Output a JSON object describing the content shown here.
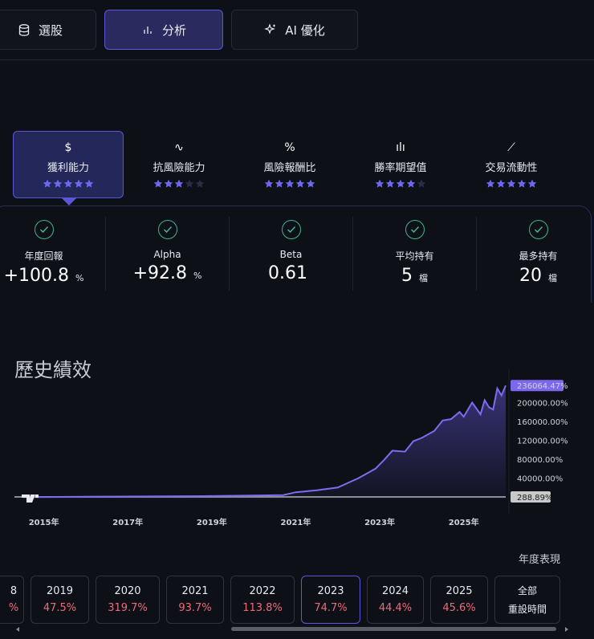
{
  "tabs": [
    {
      "label": "選股",
      "icon": "database-icon"
    },
    {
      "label": "分析",
      "icon": "bar-chart-icon"
    },
    {
      "label": "AI 優化",
      "icon": "sparkle-icon"
    }
  ],
  "metrics": [
    {
      "icon_text": "$",
      "label": "獲利能力",
      "stars": 5
    },
    {
      "icon_text": "∿",
      "label": "抗風險能力",
      "stars": 3
    },
    {
      "icon_text": "%",
      "label": "風險報酬比",
      "stars": 5
    },
    {
      "icon_text": "ılı",
      "label": "勝率期望值",
      "stars": 4
    },
    {
      "icon_text": "⟋",
      "label": "交易流動性",
      "stars": 5
    }
  ],
  "stats": [
    {
      "label": "年度回報",
      "value": "+100.8",
      "unit": "%"
    },
    {
      "label": "Alpha",
      "value": "+92.8",
      "unit": "%"
    },
    {
      "label": "Beta",
      "value": "0.61",
      "unit": ""
    },
    {
      "label": "平均持有",
      "value": "5",
      "unit": "檔"
    },
    {
      "label": "最多持有",
      "value": "20",
      "unit": "檔"
    }
  ],
  "history": {
    "title": "歷史績效"
  },
  "chart_data": {
    "type": "area",
    "title": "歷史績效",
    "x": [
      2014.5,
      2015.0,
      2016.0,
      2017.0,
      2018.0,
      2019.0,
      2020.0,
      2020.7,
      2021.0,
      2021.5,
      2022.0,
      2022.5,
      2022.9,
      2023.1,
      2023.3,
      2023.6,
      2023.8,
      2024.0,
      2024.3,
      2024.5,
      2024.7,
      2024.9,
      2025.0,
      2025.2,
      2025.4,
      2025.5,
      2025.6,
      2025.7,
      2025.8,
      2025.9,
      2026.0
    ],
    "y": [
      0,
      0,
      500,
      1000,
      1500,
      2000,
      3000,
      4000,
      10000,
      14000,
      20000,
      40000,
      60000,
      78000,
      98000,
      96000,
      118000,
      125000,
      140000,
      162000,
      165000,
      180000,
      170000,
      200000,
      175000,
      205000,
      190000,
      185000,
      230000,
      215000,
      236064
    ],
    "y_ticks": [
      "200000.00%",
      "160000.00%",
      "120000.00%",
      "80000.00%",
      "40000.00%"
    ],
    "y_tick_values": [
      200000,
      160000,
      120000,
      80000,
      40000
    ],
    "x_ticks": [
      "2015年",
      "2017年",
      "2019年",
      "2021年",
      "2023年",
      "2025年"
    ],
    "x_tick_values": [
      2015,
      2017,
      2019,
      2021,
      2023,
      2025
    ],
    "last_value_label": "236064.47%",
    "baseline_label": "288.89%",
    "ylim": [
      -5000,
      250000
    ],
    "xlim": [
      2014.3,
      2026.0
    ],
    "colors": {
      "line": "#7f6bf0",
      "baseline": "#8a8d96",
      "last_badge": "#7c68ee",
      "baseline_badge": "#c9c9c9"
    }
  },
  "annual": {
    "title": "年度表現",
    "years": [
      {
        "year": "8",
        "pct": "%"
      },
      {
        "year": "2019",
        "pct": "47.5%"
      },
      {
        "year": "2020",
        "pct": "319.7%"
      },
      {
        "year": "2021",
        "pct": "93.7%"
      },
      {
        "year": "2022",
        "pct": "113.8%"
      },
      {
        "year": "2023",
        "pct": "74.7%"
      },
      {
        "year": "2024",
        "pct": "44.4%"
      },
      {
        "year": "2025",
        "pct": "45.6%"
      }
    ],
    "all_label": "全部",
    "reset_label": "重設時間"
  }
}
